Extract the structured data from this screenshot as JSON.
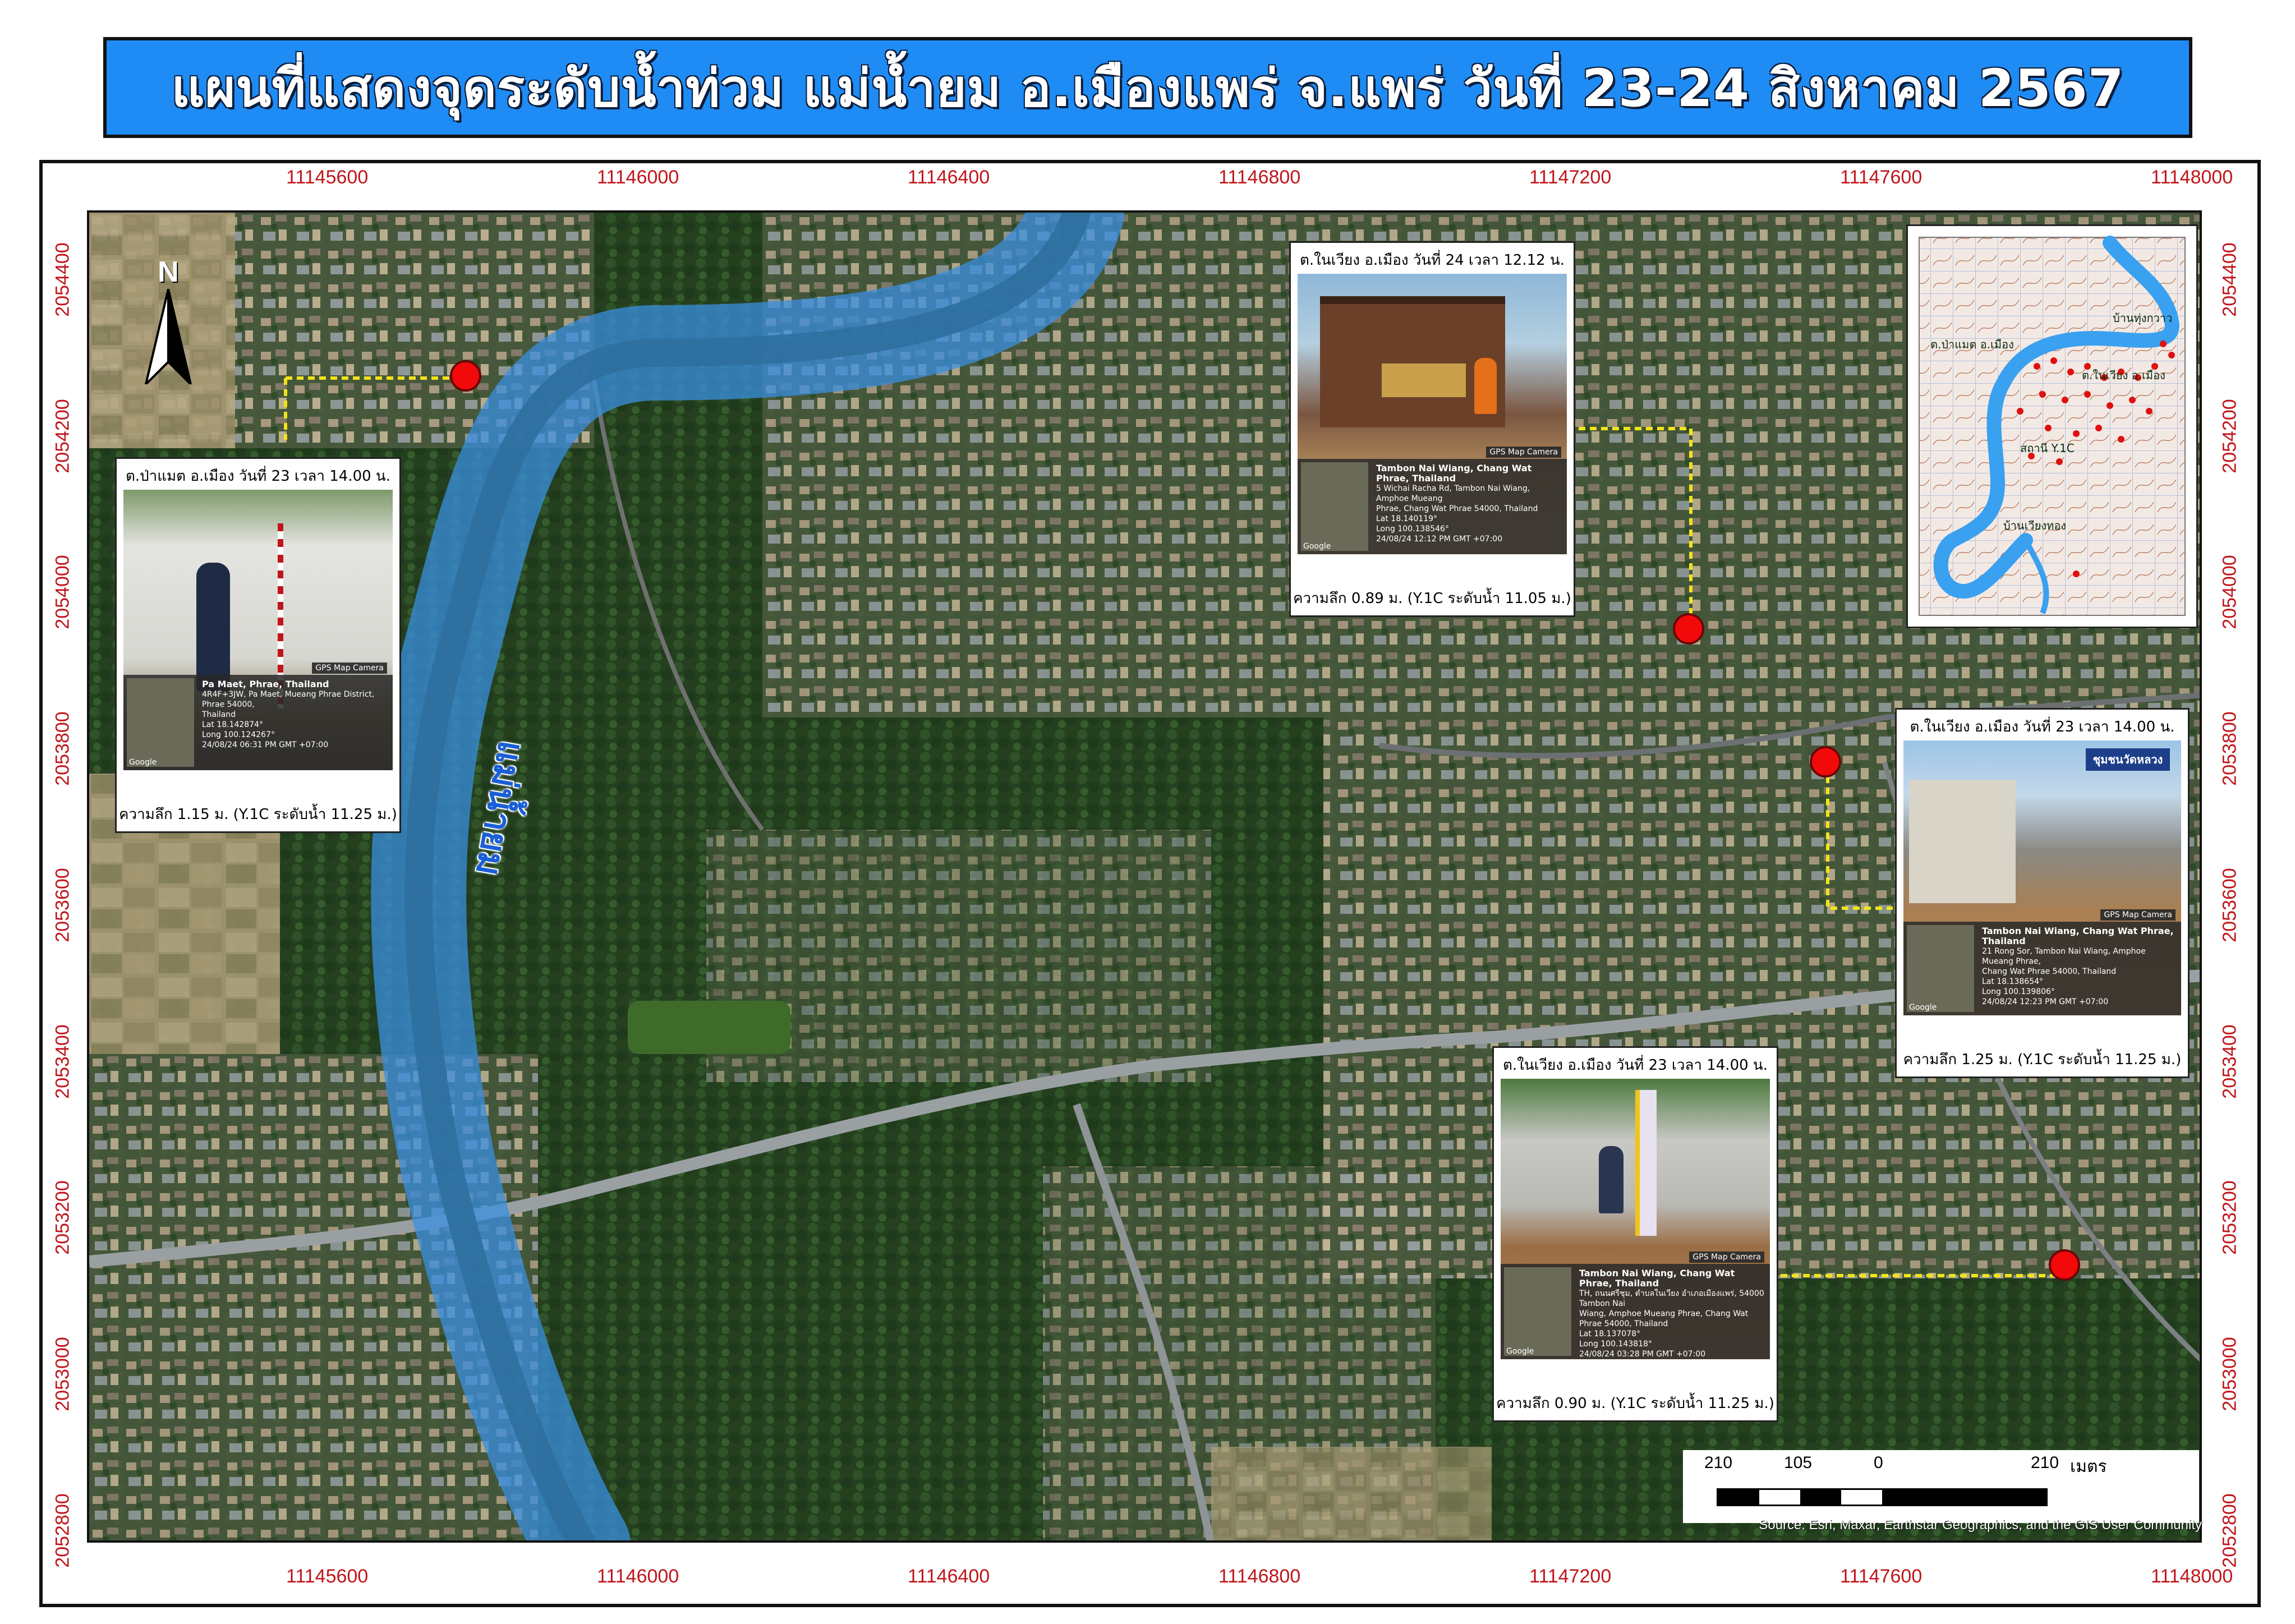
{
  "title": "แผนที่แสดงจุดระดับน้ำท่วม แม่น้ำยม อ.เมืองแพร่ จ.แพร่ วันที่ 23-24 สิงหาคม 2567",
  "colors": {
    "title_bg": "#1f8bf4",
    "tick_labels": "#c0151b",
    "flood_point": "#f20a0a",
    "leader_line": "#f2e31a",
    "river": "#3a8fe0"
  },
  "axes": {
    "x_ticks_top": [
      "11145600",
      "11146000",
      "11146400",
      "11146800",
      "11147200",
      "11147600",
      "11148000"
    ],
    "x_ticks_bottom": [
      "11145600",
      "11146000",
      "11146400",
      "11146800",
      "11147200",
      "11147600",
      "11148000"
    ],
    "y_ticks_left": [
      "2054400",
      "2054200",
      "2054000",
      "2053800",
      "2053600",
      "2053400",
      "2053200",
      "2053000",
      "2052800"
    ],
    "y_ticks_right": [
      "2054400",
      "2054200",
      "2054000",
      "2053800",
      "2053600",
      "2053400",
      "2053200",
      "2053000",
      "2052800"
    ]
  },
  "north_arrow": {
    "label": "N",
    "icon": "north-arrow-icon"
  },
  "river_label": "แม่น้ำยม",
  "callouts": [
    {
      "id": "pa-maet",
      "caption_top": "ต.ป่าแมต อ.เมือง วันที่ 23 เวลา 14.00 น.",
      "caption_bottom": "ความลึก 1.15 ม. (Y.1C ระดับน้ำ 11.25 ม.)",
      "gps_tag": "GPS Map Camera",
      "gps_place": "Pa Maet, Phrae, Thailand",
      "gps_lines": [
        "4R4F+3JW, Pa Maet, Mueang Phrae District, Phrae 54000,",
        "Thailand",
        "Lat 18.142874°",
        "Long 100.124267°",
        "24/08/24 06:31 PM GMT +07:00"
      ],
      "google": "Google"
    },
    {
      "id": "nai-wiang-24",
      "caption_top": "ต.ในเวียง อ.เมือง วันที่ 24 เวลา 12.12 น.",
      "caption_bottom": "ความลึก 0.89 ม. (Y.1C ระดับน้ำ 11.05 ม.)",
      "gps_tag": "GPS Map Camera",
      "gps_place": "Tambon Nai Wiang, Chang Wat Phrae, Thailand",
      "gps_lines": [
        "5 Wichai Racha Rd, Tambon Nai Wiang, Amphoe Mueang",
        "Phrae, Chang Wat Phrae 54000, Thailand",
        "Lat 18.140119°",
        "Long 100.138546°",
        "24/08/24 12:12 PM GMT +07:00"
      ],
      "google": "Google"
    },
    {
      "id": "nai-wiang-23-east",
      "caption_top": "ต.ในเวียง อ.เมือง วันที่ 23 เวลา 14.00 น.",
      "caption_bottom": "ความลึก 1.25 ม. (Y.1C ระดับน้ำ 11.25 ม.)",
      "gps_tag": "GPS Map Camera",
      "gps_place": "Tambon Nai Wiang, Chang Wat Phrae, Thailand",
      "gps_lines": [
        "21 Rong Sor, Tambon Nai Wiang, Amphoe Mueang Phrae,",
        "Chang Wat Phrae 54000, Thailand",
        "Lat 18.138654°",
        "Long 100.139806°",
        "24/08/24 12:23 PM GMT +07:00"
      ],
      "google": "Google",
      "sign_text": "ชุมชนวัดหลวง"
    },
    {
      "id": "nai-wiang-23-south",
      "caption_top": "ต.ในเวียง อ.เมือง วันที่ 23 เวลา 14.00 น.",
      "caption_bottom": "ความลึก 0.90 ม. (Y.1C ระดับน้ำ 11.25 ม.)",
      "gps_tag": "GPS Map Camera",
      "gps_place": "Tambon Nai Wiang, Chang Wat Phrae, Thailand",
      "gps_lines": [
        "TH, ถนนศรีชุม, ตำบลในเวียง อำเภอเมืองแพร่, 54000 Tambon Nai",
        "Wiang, Amphoe Mueang Phrae, Chang Wat Phrae 54000, Thailand",
        "Lat 18.137078°",
        "Long 100.143818°",
        "24/08/24 03:28 PM GMT +07:00"
      ],
      "google": "Google"
    }
  ],
  "inset": {
    "labels": [
      "ต.ป่าแมต อ.เมือง",
      "ต.ในเวียง อ.เมือง",
      "บ้านทุ่งกวาว",
      "สถานี Y.1C",
      "บ้านเวียงทอง"
    ]
  },
  "scale_bar": {
    "labels": [
      "210",
      "105",
      "0",
      "210"
    ],
    "unit": "เมตร"
  },
  "source": "Source: Esri, Maxar, Earthstar Geographics, and the GIS User Community"
}
